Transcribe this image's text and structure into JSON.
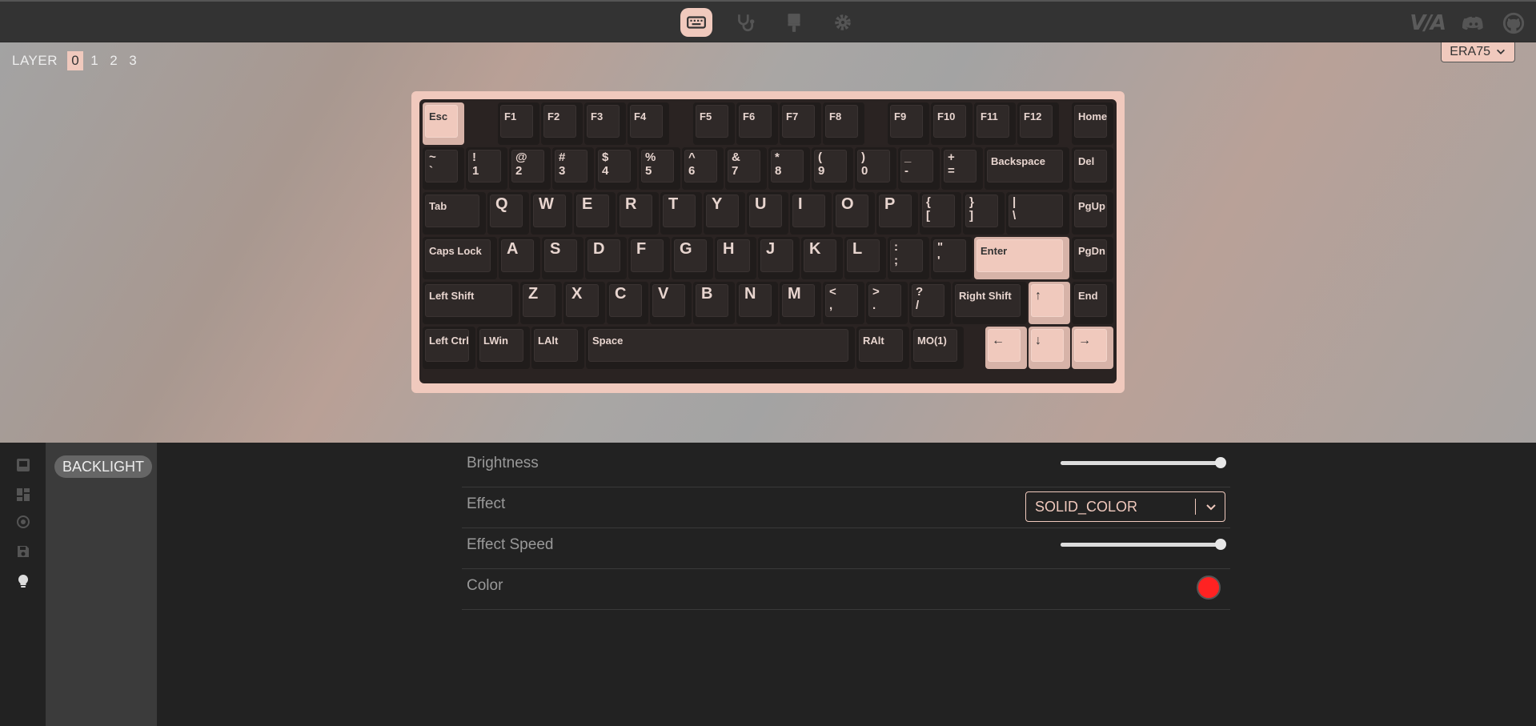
{
  "topbar": {
    "logo_text": "V/A",
    "nav_icons": [
      "keyboard-icon",
      "stethoscope-icon",
      "brush-icon",
      "gear-icon"
    ],
    "right_icons": [
      "discord-icon",
      "github-icon"
    ]
  },
  "layers": {
    "label": "LAYER",
    "items": [
      "0",
      "1",
      "2",
      "3"
    ],
    "active": "0"
  },
  "device": {
    "name": "ERA75"
  },
  "keys": {
    "esc": "Esc",
    "f1": "F1",
    "f2": "F2",
    "f3": "F3",
    "f4": "F4",
    "f5": "F5",
    "f6": "F6",
    "f7": "F7",
    "f8": "F8",
    "f9": "F9",
    "f10": "F10",
    "f11": "F11",
    "f12": "F12",
    "home": "Home",
    "grave": "~\n`",
    "n1": "!\n1",
    "n2": "@\n2",
    "n3": "#\n3",
    "n4": "$\n4",
    "n5": "%\n5",
    "n6": "^\n6",
    "n7": "&\n7",
    "n8": "*\n8",
    "n9": "(\n9",
    "n0": ")\n0",
    "minus": "_\n-",
    "equal": "+\n=",
    "backspace": "Backspace",
    "del": "Del",
    "tab": "Tab",
    "q": "Q",
    "w": "W",
    "e": "E",
    "r": "R",
    "t": "T",
    "y": "Y",
    "u": "U",
    "i": "I",
    "o": "O",
    "p": "P",
    "lbracket": "{\n[",
    "rbracket": "}\n]",
    "backslash": "|\n\\",
    "pgup": "PgUp",
    "caps": "Caps Lock",
    "a": "A",
    "s": "S",
    "d": "D",
    "f": "F",
    "g": "G",
    "h": "H",
    "j": "J",
    "k": "K",
    "l": "L",
    "semicolon": ":\n;",
    "quote": "\"\n'",
    "enter": "Enter",
    "pgdn": "PgDn",
    "lshift": "Left Shift",
    "z": "Z",
    "x": "X",
    "c": "C",
    "v": "V",
    "b": "B",
    "n": "N",
    "m": "M",
    "comma": "<\n,",
    "period": ">\n.",
    "slash": "?\n/",
    "rshift": "Right Shift",
    "up": "↑",
    "end": "End",
    "lctrl": "Left Ctrl",
    "lwin": "LWin",
    "lalt": "LAlt",
    "space": "Space",
    "ralt": "RAlt",
    "mo1": "MO(1)",
    "left": "←",
    "down": "↓",
    "right": "→"
  },
  "sidebar": {
    "icons": [
      "keycap-icon",
      "grid-icon",
      "macro-icon",
      "save-icon",
      "bulb-icon"
    ],
    "menu_item": "BACKLIGHT"
  },
  "settings": {
    "brightness": {
      "label": "Brightness",
      "value": 1.0
    },
    "effect": {
      "label": "Effect",
      "value": "SOLID_COLOR"
    },
    "effect_speed": {
      "label": "Effect Speed",
      "value": 1.0
    },
    "color": {
      "label": "Color",
      "value": "#ff2222"
    }
  }
}
